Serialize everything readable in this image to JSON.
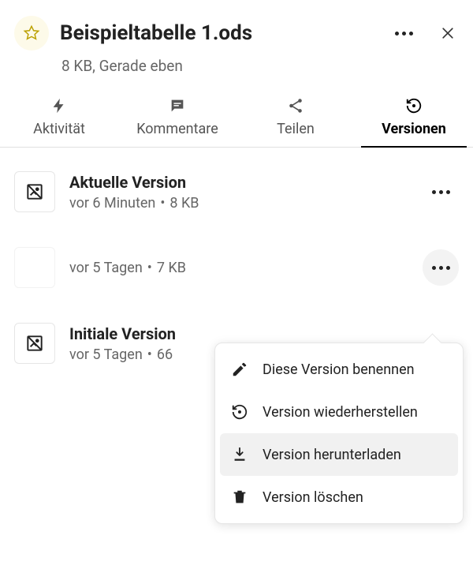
{
  "header": {
    "title": "Beispieltabelle 1.ods",
    "subtitle": "8 KB, Gerade eben"
  },
  "tabs": [
    {
      "label": "Aktivität",
      "icon": "bolt-icon"
    },
    {
      "label": "Kommentare",
      "icon": "comment-icon"
    },
    {
      "label": "Teilen",
      "icon": "share-icon"
    },
    {
      "label": "Versionen",
      "icon": "history-icon"
    }
  ],
  "active_tab": "Versionen",
  "versions": [
    {
      "title": "Aktuelle Version",
      "time": "vor 6 Minuten",
      "size": "8 KB",
      "thumb": true
    },
    {
      "title": "",
      "time": "vor 5 Tagen",
      "size": "7 KB",
      "thumb": false,
      "menu_open": true
    },
    {
      "title": "Initiale Version",
      "time": "vor 5 Tagen",
      "size": "66",
      "thumb": true
    }
  ],
  "menu": {
    "rename": "Diese Version benennen",
    "restore": "Version wiederherstellen",
    "download": "Version herunterladen",
    "delete": "Version löschen"
  }
}
